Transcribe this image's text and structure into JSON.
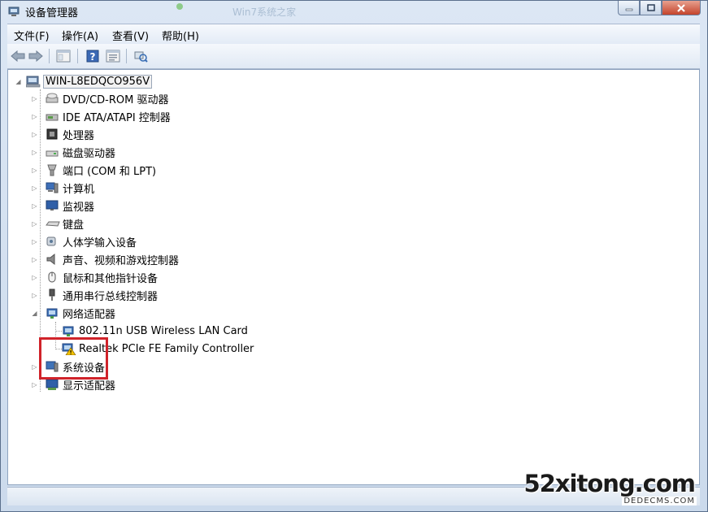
{
  "window": {
    "title": "设备管理器",
    "background_title": "Win7系统之家"
  },
  "menu": [
    {
      "label": "文件(F)"
    },
    {
      "label": "操作(A)"
    },
    {
      "label": "查看(V)"
    },
    {
      "label": "帮助(H)"
    }
  ],
  "toolbar": {
    "icons": [
      "back-arrow-icon",
      "forward-arrow-icon",
      "show-hide-tree-icon",
      "help-icon",
      "properties-icon",
      "scan-hardware-icon"
    ]
  },
  "tree": {
    "root": "WIN-L8EDQCO956V",
    "categories": [
      {
        "label": "DVD/CD-ROM 驱动器"
      },
      {
        "label": "IDE ATA/ATAPI 控制器"
      },
      {
        "label": "处理器"
      },
      {
        "label": "磁盘驱动器"
      },
      {
        "label": "端口 (COM 和 LPT)"
      },
      {
        "label": "计算机"
      },
      {
        "label": "监视器"
      },
      {
        "label": "键盘"
      },
      {
        "label": "人体学输入设备"
      },
      {
        "label": "声音、视频和游戏控制器"
      },
      {
        "label": "鼠标和其他指针设备"
      },
      {
        "label": "通用串行总线控制器"
      },
      {
        "label": "网络适配器"
      },
      {
        "label": "系统设备"
      },
      {
        "label": "显示适配器"
      }
    ],
    "network_children": [
      {
        "label": "802.11n USB Wireless LAN Card"
      },
      {
        "label": "Realtek PCIe FE Family Controller"
      }
    ]
  },
  "watermark": {
    "main": "52xitong.com",
    "sub": "DEDECMS.COM"
  },
  "colors": {
    "highlight": "#d0232a",
    "warning": "#f5c400"
  }
}
